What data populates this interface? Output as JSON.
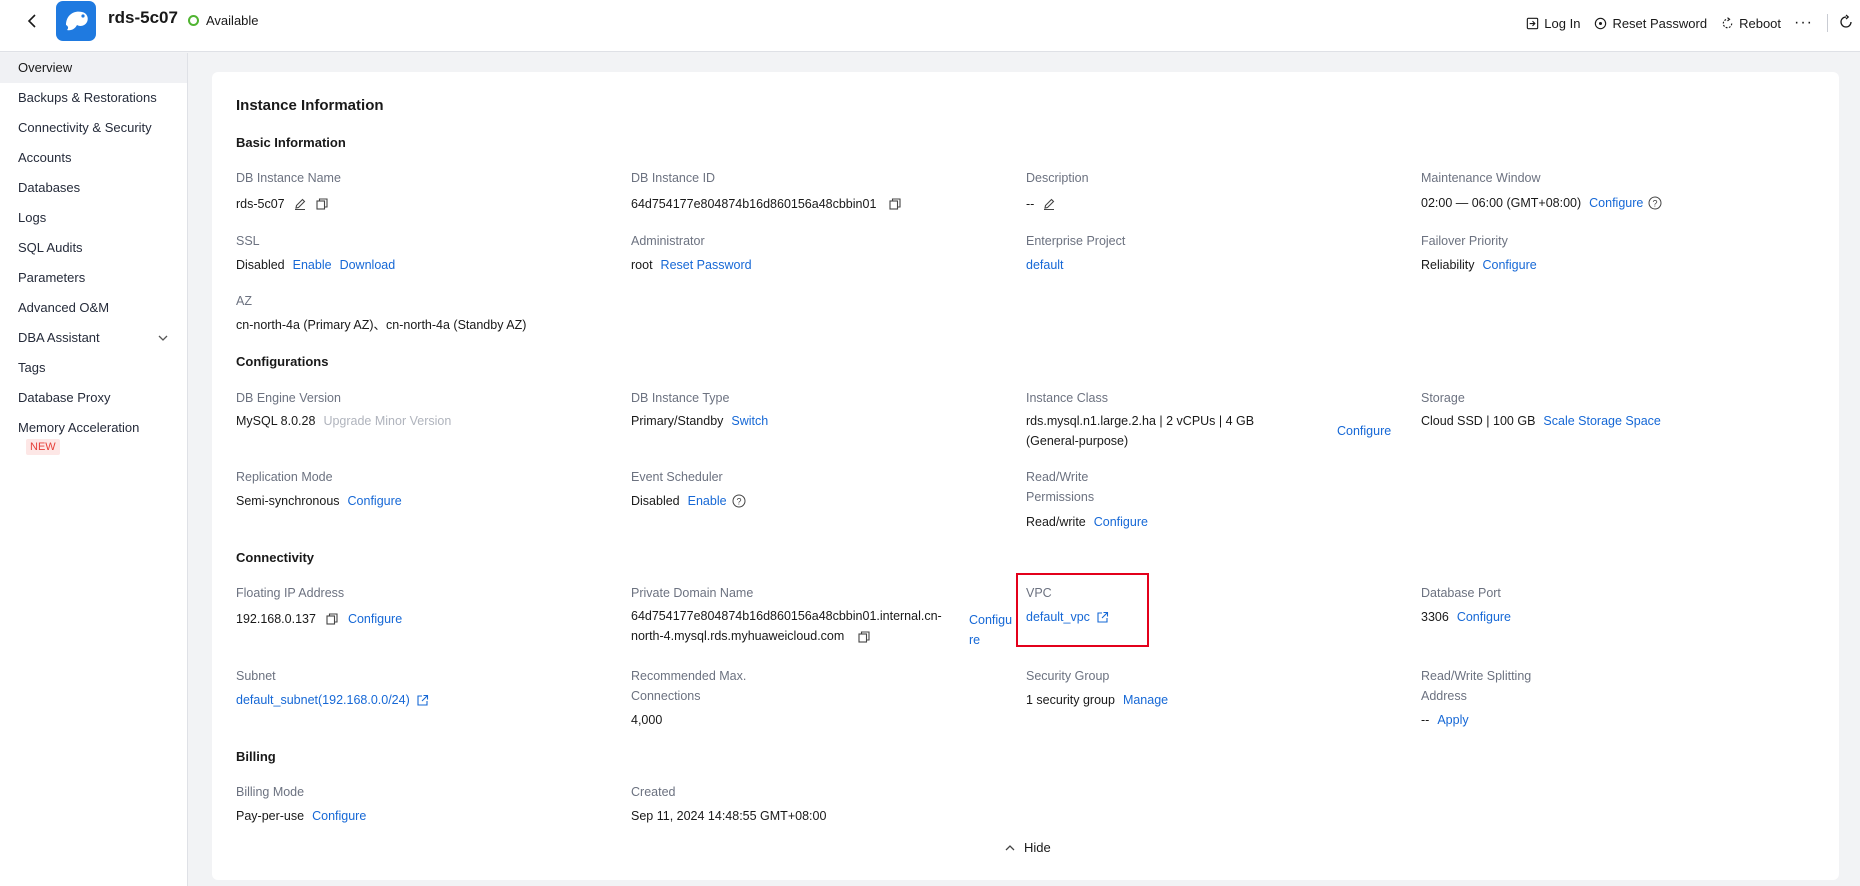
{
  "header": {
    "instance_name": "rds-5c07",
    "status": "Available",
    "actions": {
      "log_in": "Log In",
      "reset_password": "Reset Password",
      "reboot": "Reboot",
      "more": "···"
    }
  },
  "sidebar": {
    "items": [
      {
        "label": "Overview"
      },
      {
        "label": "Backups & Restorations"
      },
      {
        "label": "Connectivity & Security"
      },
      {
        "label": "Accounts"
      },
      {
        "label": "Databases"
      },
      {
        "label": "Logs"
      },
      {
        "label": "SQL Audits"
      },
      {
        "label": "Parameters"
      },
      {
        "label": "Advanced O&M"
      },
      {
        "label": "DBA Assistant"
      },
      {
        "label": "Tags"
      },
      {
        "label": "Database Proxy"
      },
      {
        "label": "Memory Acceleration"
      }
    ],
    "new_badge": "NEW"
  },
  "main": {
    "title": "Instance Information",
    "basic": {
      "heading": "Basic Information",
      "db_instance_name_label": "DB Instance Name",
      "db_instance_name": "rds-5c07",
      "db_instance_id_label": "DB Instance ID",
      "db_instance_id": "64d754177e804874b16d860156a48cbbin01",
      "description_label": "Description",
      "description": "--",
      "maintenance_label": "Maintenance Window",
      "maintenance": "02:00 — 06:00 (GMT+08:00)",
      "maintenance_link": "Configure",
      "ssl_label": "SSL",
      "ssl": "Disabled",
      "ssl_enable": "Enable",
      "ssl_download": "Download",
      "admin_label": "Administrator",
      "admin": "root",
      "admin_reset": "Reset Password",
      "ep_label": "Enterprise Project",
      "ep": "default",
      "failover_label": "Failover Priority",
      "failover": "Reliability",
      "failover_link": "Configure",
      "az_label": "AZ",
      "az": "cn-north-4a (Primary AZ)、cn-north-4a (Standby AZ)"
    },
    "config": {
      "heading": "Configurations",
      "engine_label": "DB Engine Version",
      "engine": "MySQL 8.0.28",
      "engine_upgrade": "Upgrade Minor Version",
      "type_label": "DB Instance Type",
      "type": "Primary/Standby",
      "type_switch": "Switch",
      "class_label": "Instance Class",
      "class": "rds.mysql.n1.large.2.ha | 2 vCPUs | 4 GB (General-purpose)",
      "class_link": "Configure",
      "storage_label": "Storage",
      "storage": "Cloud SSD | 100 GB",
      "storage_link": "Scale Storage Space",
      "replication_label": "Replication Mode",
      "replication": "Semi-synchronous",
      "replication_link": "Configure",
      "event_label": "Event Scheduler",
      "event": "Disabled",
      "event_link": "Enable",
      "rw_label": "Read/Write Permissions",
      "rw": "Read/write",
      "rw_link": "Configure"
    },
    "connectivity": {
      "heading": "Connectivity",
      "fip_label": "Floating IP Address",
      "fip": "192.168.0.137",
      "fip_link": "Configure",
      "domain_label": "Private Domain Name",
      "domain": "64d754177e804874b16d860156a48cbbin01.internal.cn-north-4.mysql.rds.myhuaweicloud.com",
      "domain_link": "Configure",
      "vpc_label": "VPC",
      "vpc": "default_vpc",
      "port_label": "Database Port",
      "port": "3306",
      "port_link": "Configure",
      "subnet_label": "Subnet",
      "subnet": "default_subnet(192.168.0.0/24)",
      "maxconn_label": "Recommended Max. Connections",
      "maxconn": "4,000",
      "sg_label": "Security Group",
      "sg": "1 security group",
      "sg_link": "Manage",
      "rws_label": "Read/Write Splitting Address",
      "rws": "--",
      "rws_link": "Apply"
    },
    "billing": {
      "heading": "Billing",
      "mode_label": "Billing Mode",
      "mode": "Pay-per-use",
      "mode_link": "Configure",
      "created_label": "Created",
      "created": "Sep 11, 2024 14:48:55 GMT+08:00"
    },
    "hide": "Hide"
  },
  "colors": {
    "link": "#1668d6",
    "accent": "#1f7ae0",
    "status_ok": "#50b431",
    "highlight": "#e3001b"
  }
}
